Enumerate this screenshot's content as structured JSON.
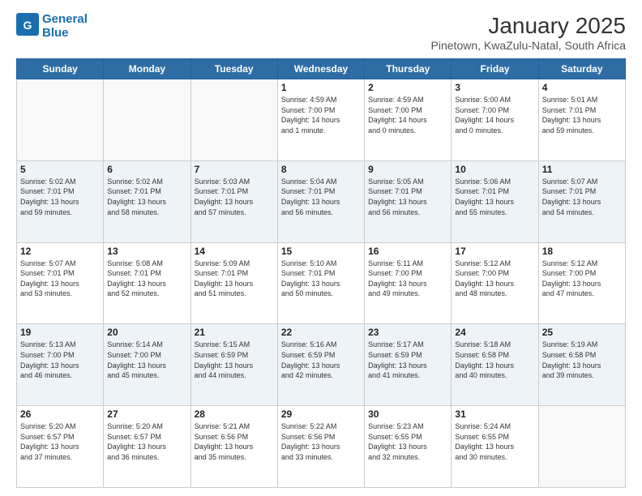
{
  "header": {
    "logo_line1": "General",
    "logo_line2": "Blue",
    "title": "January 2025",
    "subtitle": "Pinetown, KwaZulu-Natal, South Africa"
  },
  "days_of_week": [
    "Sunday",
    "Monday",
    "Tuesday",
    "Wednesday",
    "Thursday",
    "Friday",
    "Saturday"
  ],
  "weeks": [
    [
      {
        "day": "",
        "lines": []
      },
      {
        "day": "",
        "lines": []
      },
      {
        "day": "",
        "lines": []
      },
      {
        "day": "1",
        "lines": [
          "Sunrise: 4:59 AM",
          "Sunset: 7:00 PM",
          "Daylight: 14 hours",
          "and 1 minute."
        ]
      },
      {
        "day": "2",
        "lines": [
          "Sunrise: 4:59 AM",
          "Sunset: 7:00 PM",
          "Daylight: 14 hours",
          "and 0 minutes."
        ]
      },
      {
        "day": "3",
        "lines": [
          "Sunrise: 5:00 AM",
          "Sunset: 7:00 PM",
          "Daylight: 14 hours",
          "and 0 minutes."
        ]
      },
      {
        "day": "4",
        "lines": [
          "Sunrise: 5:01 AM",
          "Sunset: 7:01 PM",
          "Daylight: 13 hours",
          "and 59 minutes."
        ]
      }
    ],
    [
      {
        "day": "5",
        "lines": [
          "Sunrise: 5:02 AM",
          "Sunset: 7:01 PM",
          "Daylight: 13 hours",
          "and 59 minutes."
        ]
      },
      {
        "day": "6",
        "lines": [
          "Sunrise: 5:02 AM",
          "Sunset: 7:01 PM",
          "Daylight: 13 hours",
          "and 58 minutes."
        ]
      },
      {
        "day": "7",
        "lines": [
          "Sunrise: 5:03 AM",
          "Sunset: 7:01 PM",
          "Daylight: 13 hours",
          "and 57 minutes."
        ]
      },
      {
        "day": "8",
        "lines": [
          "Sunrise: 5:04 AM",
          "Sunset: 7:01 PM",
          "Daylight: 13 hours",
          "and 56 minutes."
        ]
      },
      {
        "day": "9",
        "lines": [
          "Sunrise: 5:05 AM",
          "Sunset: 7:01 PM",
          "Daylight: 13 hours",
          "and 56 minutes."
        ]
      },
      {
        "day": "10",
        "lines": [
          "Sunrise: 5:06 AM",
          "Sunset: 7:01 PM",
          "Daylight: 13 hours",
          "and 55 minutes."
        ]
      },
      {
        "day": "11",
        "lines": [
          "Sunrise: 5:07 AM",
          "Sunset: 7:01 PM",
          "Daylight: 13 hours",
          "and 54 minutes."
        ]
      }
    ],
    [
      {
        "day": "12",
        "lines": [
          "Sunrise: 5:07 AM",
          "Sunset: 7:01 PM",
          "Daylight: 13 hours",
          "and 53 minutes."
        ]
      },
      {
        "day": "13",
        "lines": [
          "Sunrise: 5:08 AM",
          "Sunset: 7:01 PM",
          "Daylight: 13 hours",
          "and 52 minutes."
        ]
      },
      {
        "day": "14",
        "lines": [
          "Sunrise: 5:09 AM",
          "Sunset: 7:01 PM",
          "Daylight: 13 hours",
          "and 51 minutes."
        ]
      },
      {
        "day": "15",
        "lines": [
          "Sunrise: 5:10 AM",
          "Sunset: 7:01 PM",
          "Daylight: 13 hours",
          "and 50 minutes."
        ]
      },
      {
        "day": "16",
        "lines": [
          "Sunrise: 5:11 AM",
          "Sunset: 7:00 PM",
          "Daylight: 13 hours",
          "and 49 minutes."
        ]
      },
      {
        "day": "17",
        "lines": [
          "Sunrise: 5:12 AM",
          "Sunset: 7:00 PM",
          "Daylight: 13 hours",
          "and 48 minutes."
        ]
      },
      {
        "day": "18",
        "lines": [
          "Sunrise: 5:12 AM",
          "Sunset: 7:00 PM",
          "Daylight: 13 hours",
          "and 47 minutes."
        ]
      }
    ],
    [
      {
        "day": "19",
        "lines": [
          "Sunrise: 5:13 AM",
          "Sunset: 7:00 PM",
          "Daylight: 13 hours",
          "and 46 minutes."
        ]
      },
      {
        "day": "20",
        "lines": [
          "Sunrise: 5:14 AM",
          "Sunset: 7:00 PM",
          "Daylight: 13 hours",
          "and 45 minutes."
        ]
      },
      {
        "day": "21",
        "lines": [
          "Sunrise: 5:15 AM",
          "Sunset: 6:59 PM",
          "Daylight: 13 hours",
          "and 44 minutes."
        ]
      },
      {
        "day": "22",
        "lines": [
          "Sunrise: 5:16 AM",
          "Sunset: 6:59 PM",
          "Daylight: 13 hours",
          "and 42 minutes."
        ]
      },
      {
        "day": "23",
        "lines": [
          "Sunrise: 5:17 AM",
          "Sunset: 6:59 PM",
          "Daylight: 13 hours",
          "and 41 minutes."
        ]
      },
      {
        "day": "24",
        "lines": [
          "Sunrise: 5:18 AM",
          "Sunset: 6:58 PM",
          "Daylight: 13 hours",
          "and 40 minutes."
        ]
      },
      {
        "day": "25",
        "lines": [
          "Sunrise: 5:19 AM",
          "Sunset: 6:58 PM",
          "Daylight: 13 hours",
          "and 39 minutes."
        ]
      }
    ],
    [
      {
        "day": "26",
        "lines": [
          "Sunrise: 5:20 AM",
          "Sunset: 6:57 PM",
          "Daylight: 13 hours",
          "and 37 minutes."
        ]
      },
      {
        "day": "27",
        "lines": [
          "Sunrise: 5:20 AM",
          "Sunset: 6:57 PM",
          "Daylight: 13 hours",
          "and 36 minutes."
        ]
      },
      {
        "day": "28",
        "lines": [
          "Sunrise: 5:21 AM",
          "Sunset: 6:56 PM",
          "Daylight: 13 hours",
          "and 35 minutes."
        ]
      },
      {
        "day": "29",
        "lines": [
          "Sunrise: 5:22 AM",
          "Sunset: 6:56 PM",
          "Daylight: 13 hours",
          "and 33 minutes."
        ]
      },
      {
        "day": "30",
        "lines": [
          "Sunrise: 5:23 AM",
          "Sunset: 6:55 PM",
          "Daylight: 13 hours",
          "and 32 minutes."
        ]
      },
      {
        "day": "31",
        "lines": [
          "Sunrise: 5:24 AM",
          "Sunset: 6:55 PM",
          "Daylight: 13 hours",
          "and 30 minutes."
        ]
      },
      {
        "day": "",
        "lines": []
      }
    ]
  ]
}
